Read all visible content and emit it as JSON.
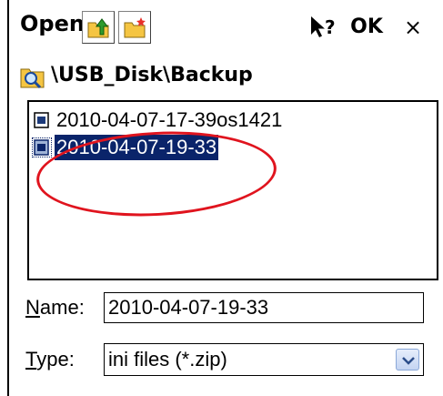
{
  "dialog": {
    "title": "Open",
    "toolbar": {
      "up_icon": "folder-up-icon",
      "new_folder_icon": "new-folder-icon",
      "help_icon": "help-pointer-icon",
      "ok_label": "OK",
      "close_label": "×"
    }
  },
  "path": {
    "icon": "folder-search-icon",
    "text": "\\USB_Disk\\Backup"
  },
  "files": [
    {
      "name": "2010-04-07-17-39os1421",
      "icon": "file-icon",
      "selected": false
    },
    {
      "name": "2010-04-07-19-33",
      "icon": "file-icon",
      "selected": true
    }
  ],
  "annotation": {
    "shape": "ellipse",
    "color": "#e0141e"
  },
  "name_field": {
    "label_underlined": "N",
    "label_rest": "ame:",
    "value": "2010-04-07-19-33"
  },
  "type_field": {
    "label_underlined": "T",
    "label_rest": "ype:",
    "value": "ini files (*.zip)",
    "dropdown_icon": "chevron-down-icon"
  },
  "colors": {
    "selection": "#0a246a",
    "annotation": "#e0141e"
  }
}
